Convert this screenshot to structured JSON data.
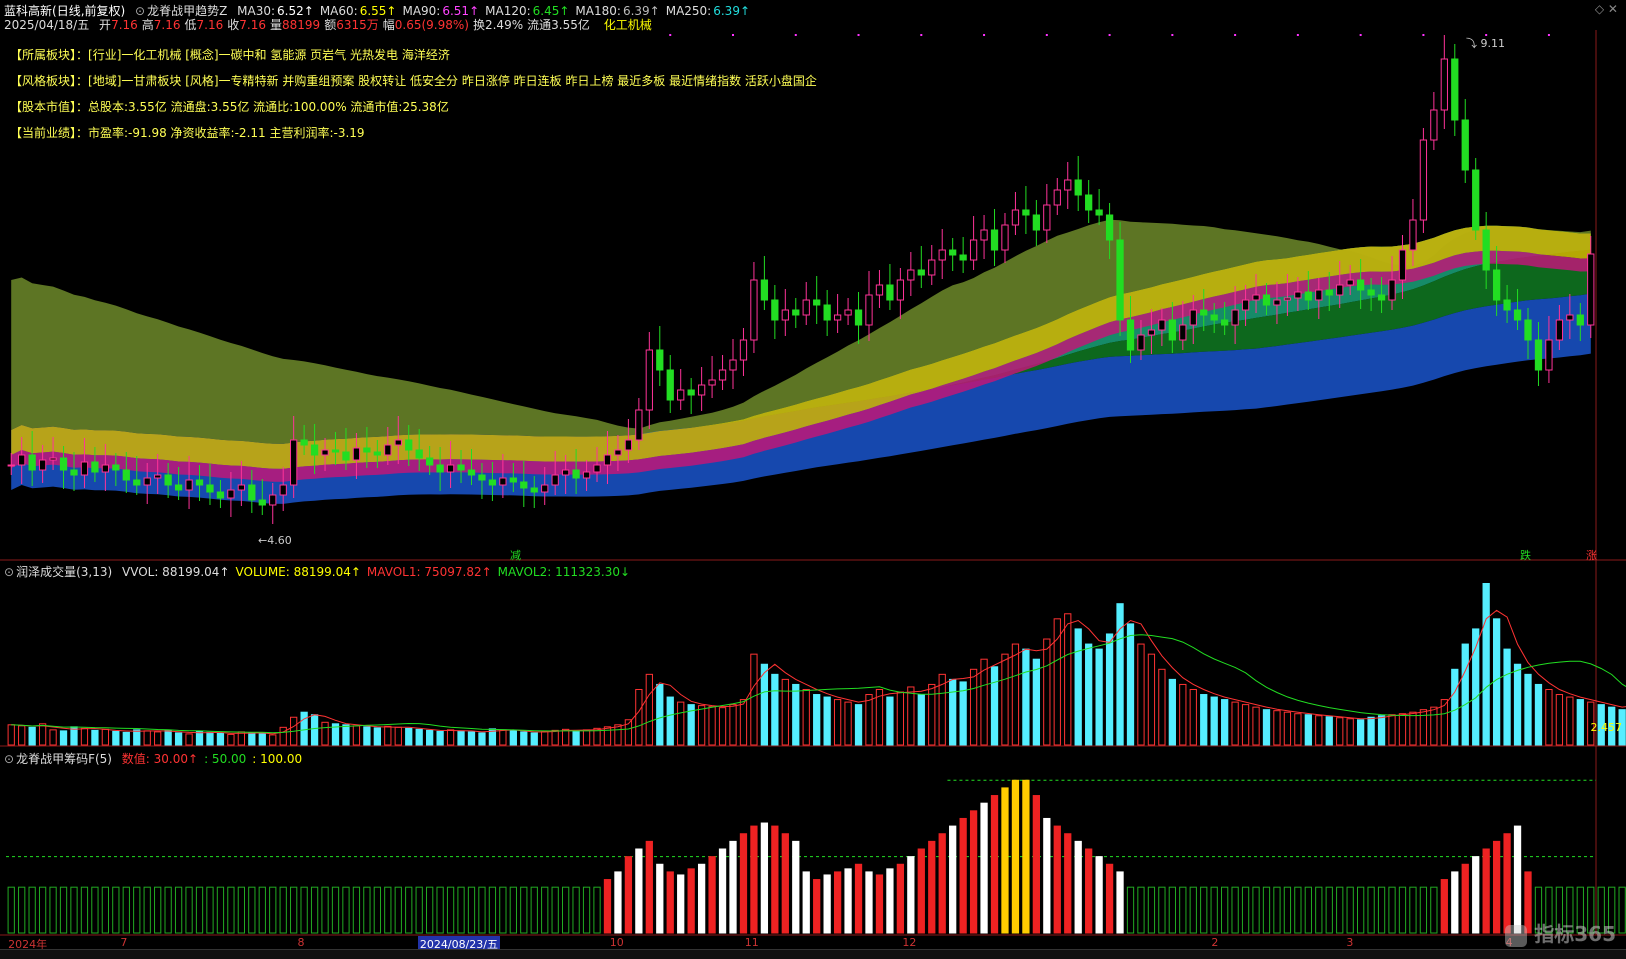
{
  "header": {
    "stock": "蓝科高新",
    "mode": "(日线,前复权)",
    "indicator": "龙脊战甲趋势Z",
    "ma": [
      {
        "label": "MA30:",
        "value": "6.52↑",
        "color": "#ffffff"
      },
      {
        "label": "MA60:",
        "value": "6.55↑",
        "color": "#ffff00"
      },
      {
        "label": "MA90:",
        "value": "6.51↑",
        "color": "#ff44ff"
      },
      {
        "label": "MA120:",
        "value": "6.45↑",
        "color": "#22dd22"
      },
      {
        "label": "MA180:",
        "value": "6.39↑",
        "color": "#bbbbbb"
      },
      {
        "label": "MA250:",
        "value": "6.39↑",
        "color": "#22dddd"
      }
    ],
    "date": "2025/04/18/五",
    "quote": [
      {
        "label": "开",
        "value": "7.16"
      },
      {
        "label": "高",
        "value": "7.16"
      },
      {
        "label": "低",
        "value": "7.16"
      },
      {
        "label": "收",
        "value": "7.16"
      },
      {
        "label": "量",
        "value": "88199"
      },
      {
        "label": "额",
        "value": "6315万"
      },
      {
        "label": "幅",
        "value": "0.65(9.98%)"
      },
      {
        "label": "换",
        "value": "2.49%"
      },
      {
        "label": "流通",
        "value": "3.55亿"
      }
    ],
    "sector": "化工机械"
  },
  "info_lines": [
    {
      "key": "【所属板块】：",
      "value": "[行业]一化工机械 [概念]一碳中和 氢能源 页岩气 光热发电 海洋经济"
    },
    {
      "key": "【风格板块】：",
      "value": "[地域]一甘肃板块 [风格]一专精特新 并购重组预案 股权转让 低安全分 昨日涨停 昨日连板 昨日上榜 最近多板 最近情绪指数 活跃小盘国企"
    },
    {
      "key": "【股本市值】：",
      "value": "总股本:3.55亿 流通盘:3.55亿 流通比:100.00% 流通市值:25.38亿"
    },
    {
      "key": "【当前业绩】：",
      "value": "市盈率:-91.98 净资收益率:-2.11 主营利润率:-3.19"
    }
  ],
  "markers": {
    "high": "9.11",
    "low": "4.60",
    "sig1": "减",
    "sig2": "跌",
    "sig3": "涨"
  },
  "volume_header": {
    "name": "润泽成交量(3,13)",
    "items": [
      {
        "label": "VVOL: 88199.04↑",
        "color": "#dddddd"
      },
      {
        "label": "VOLUME: 88199.04↑",
        "color": "#ffff00"
      },
      {
        "label": "MAVOL1: 75097.82↑",
        "color": "#ff3333"
      },
      {
        "label": "MAVOL2: 111323.30↓",
        "color": "#22dd22"
      }
    ],
    "right_value": "2.457"
  },
  "chip_header": {
    "name": "龙脊战甲筹码F(5)",
    "items": [
      {
        "label": "数值: 30.00↑",
        "color": "#ff3333"
      },
      {
        "label": ": 50.00",
        "color": "#22dd22"
      },
      {
        "label": ": 100.00",
        "color": "#ffff00"
      }
    ]
  },
  "time_axis": [
    {
      "label": "2024年",
      "pos": 0.005
    },
    {
      "label": "7",
      "pos": 0.074
    },
    {
      "label": "8",
      "pos": 0.183
    },
    {
      "label": "2024/08/23/五",
      "pos": 0.257,
      "highlight": true
    },
    {
      "label": "10",
      "pos": 0.375
    },
    {
      "label": "11",
      "pos": 0.458
    },
    {
      "label": "12",
      "pos": 0.555
    },
    {
      "label": "2",
      "pos": 0.745
    },
    {
      "label": "3",
      "pos": 0.828
    },
    {
      "label": "4",
      "pos": 0.926
    }
  ],
  "watermark": "指标365",
  "chart_data": {
    "type": "candlestick",
    "title": "蓝科高新 (日线,前复权)",
    "xlabel": "",
    "ylabel": "",
    "ylim": [
      4.3,
      9.3
    ],
    "x_range": [
      "2024-06",
      "2025-04-18"
    ],
    "price_labels": {
      "high": 9.11,
      "low": 4.6,
      "last_close": 7.16
    },
    "ma_last": {
      "MA30": 6.52,
      "MA60": 6.55,
      "MA90": 6.51,
      "MA120": 6.45,
      "MA180": 6.39,
      "MA250": 6.39
    },
    "closes": [
      5.05,
      5.15,
      5.0,
      5.1,
      5.12,
      5.0,
      4.95,
      5.08,
      4.98,
      5.05,
      5.0,
      4.9,
      4.85,
      4.92,
      4.95,
      4.85,
      4.8,
      4.9,
      4.85,
      4.78,
      4.72,
      4.8,
      4.85,
      4.7,
      4.65,
      4.75,
      4.85,
      5.3,
      5.25,
      5.15,
      5.2,
      5.18,
      5.1,
      5.22,
      5.18,
      5.15,
      5.25,
      5.3,
      5.2,
      5.12,
      5.05,
      4.98,
      5.05,
      5.0,
      4.95,
      4.9,
      4.85,
      4.92,
      4.88,
      4.82,
      4.78,
      4.85,
      4.95,
      5.0,
      4.92,
      4.98,
      5.05,
      5.15,
      5.2,
      5.3,
      5.6,
      6.2,
      6.0,
      5.7,
      5.8,
      5.75,
      5.85,
      5.9,
      6.0,
      6.1,
      6.3,
      6.9,
      6.7,
      6.5,
      6.6,
      6.55,
      6.7,
      6.65,
      6.5,
      6.55,
      6.6,
      6.45,
      6.75,
      6.85,
      6.7,
      6.9,
      7.0,
      6.95,
      7.1,
      7.2,
      7.15,
      7.1,
      7.3,
      7.4,
      7.2,
      7.45,
      7.6,
      7.55,
      7.4,
      7.65,
      7.8,
      7.9,
      7.75,
      7.6,
      7.55,
      7.3,
      6.5,
      6.2,
      6.35,
      6.4,
      6.5,
      6.3,
      6.45,
      6.6,
      6.55,
      6.5,
      6.45,
      6.6,
      6.7,
      6.75,
      6.65,
      6.7,
      6.72,
      6.78,
      6.7,
      6.8,
      6.75,
      6.85,
      6.9,
      6.8,
      6.75,
      6.7,
      6.9,
      7.2,
      7.5,
      8.3,
      8.6,
      9.11,
      8.5,
      8.0,
      7.4,
      7.0,
      6.7,
      6.6,
      6.5,
      6.3,
      6.0,
      6.3,
      6.5,
      6.55,
      6.45,
      7.16
    ],
    "volume_ylim": [
      0,
      330000
    ],
    "volume_last": {
      "VVOL": 88199.04,
      "VOLUME": 88199.04,
      "MAVOL1": 75097.82,
      "MAVOL2": 111323.3
    },
    "volumes": [
      40,
      38,
      35,
      42,
      30,
      28,
      36,
      33,
      29,
      31,
      27,
      25,
      30,
      28,
      26,
      29,
      24,
      22,
      27,
      25,
      23,
      21,
      26,
      24,
      22,
      20,
      35,
      55,
      65,
      60,
      45,
      42,
      40,
      38,
      36,
      34,
      37,
      35,
      33,
      31,
      29,
      27,
      30,
      28,
      26,
      24,
      32,
      30,
      28,
      26,
      24,
      27,
      29,
      31,
      28,
      30,
      33,
      36,
      40,
      50,
      110,
      140,
      120,
      95,
      85,
      80,
      78,
      76,
      74,
      80,
      90,
      180,
      160,
      140,
      130,
      120,
      110,
      100,
      95,
      90,
      85,
      80,
      100,
      110,
      95,
      105,
      115,
      100,
      120,
      140,
      130,
      125,
      150,
      170,
      155,
      180,
      200,
      190,
      170,
      210,
      250,
      260,
      230,
      200,
      190,
      220,
      280,
      240,
      200,
      180,
      150,
      130,
      120,
      110,
      100,
      95,
      90,
      85,
      80,
      75,
      70,
      68,
      65,
      62,
      60,
      58,
      56,
      54,
      52,
      50,
      55,
      58,
      60,
      62,
      65,
      70,
      75,
      90,
      150,
      200,
      230,
      320,
      250,
      190,
      160,
      140,
      120,
      110,
      100,
      95,
      90,
      85,
      80,
      75,
      70,
      88
    ],
    "chip_ylim": [
      0,
      110
    ],
    "chip_levels": {
      "mid": 50,
      "high": 100,
      "current": 30
    },
    "chips": [
      30,
      30,
      30,
      30,
      30,
      30,
      30,
      30,
      30,
      30,
      30,
      30,
      30,
      30,
      30,
      30,
      30,
      30,
      30,
      30,
      30,
      30,
      30,
      30,
      30,
      30,
      30,
      30,
      30,
      30,
      30,
      30,
      30,
      30,
      30,
      30,
      30,
      30,
      30,
      30,
      30,
      30,
      30,
      30,
      30,
      30,
      30,
      30,
      30,
      30,
      30,
      30,
      30,
      30,
      30,
      30,
      30,
      35,
      40,
      50,
      55,
      60,
      45,
      40,
      38,
      42,
      45,
      50,
      55,
      60,
      65,
      70,
      72,
      70,
      65,
      60,
      40,
      35,
      38,
      40,
      42,
      45,
      40,
      38,
      42,
      45,
      50,
      55,
      60,
      65,
      70,
      75,
      80,
      85,
      90,
      95,
      100,
      100,
      90,
      75,
      70,
      65,
      60,
      55,
      50,
      45,
      40,
      30,
      30,
      30,
      30,
      30,
      30,
      30,
      30,
      30,
      30,
      30,
      30,
      30,
      30,
      30,
      30,
      30,
      30,
      30,
      30,
      30,
      30,
      30,
      30,
      30,
      30,
      30,
      30,
      30,
      30,
      35,
      40,
      45,
      50,
      55,
      60,
      65,
      70,
      40,
      30,
      30,
      30,
      30,
      30,
      30,
      30,
      30,
      30,
      30,
      30,
      35
    ]
  }
}
